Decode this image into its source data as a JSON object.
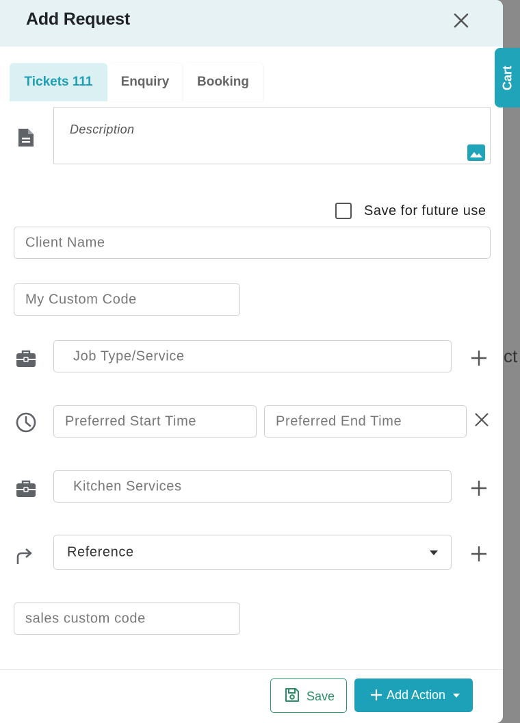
{
  "background": {
    "peek_text": "ct"
  },
  "header": {
    "title": "Add Request"
  },
  "tabs": [
    {
      "label": "Tickets 111",
      "active": true
    },
    {
      "label": "Enquiry",
      "active": false
    },
    {
      "label": "Booking",
      "active": false
    }
  ],
  "cart_tab": {
    "label": "Cart"
  },
  "form": {
    "description_placeholder": "Description",
    "save_for_future_label": "Save for future use",
    "save_for_future_checked": false,
    "client_name_placeholder": "Client Name",
    "custom_code_placeholder": "My Custom Code",
    "job_type_placeholder": "Job Type/Service",
    "start_time_placeholder": "Preferred Start Time",
    "end_time_placeholder": "Preferred End Time",
    "kitchen_services_value": "Kitchen Services",
    "reference_value": "Reference",
    "sales_code_placeholder": "sales custom code"
  },
  "footer": {
    "save_label": "Save",
    "add_action_label": "Add Action"
  },
  "colors": {
    "accent": "#20a4b9",
    "save_green": "#28996b",
    "header_bg": "#e6f2f4"
  },
  "icons": [
    "close-icon",
    "document-icon",
    "image-icon",
    "briefcase-icon",
    "clock-icon",
    "plus-icon",
    "redirect-arrow-icon",
    "caret-down-icon",
    "floppy-disk-icon"
  ]
}
